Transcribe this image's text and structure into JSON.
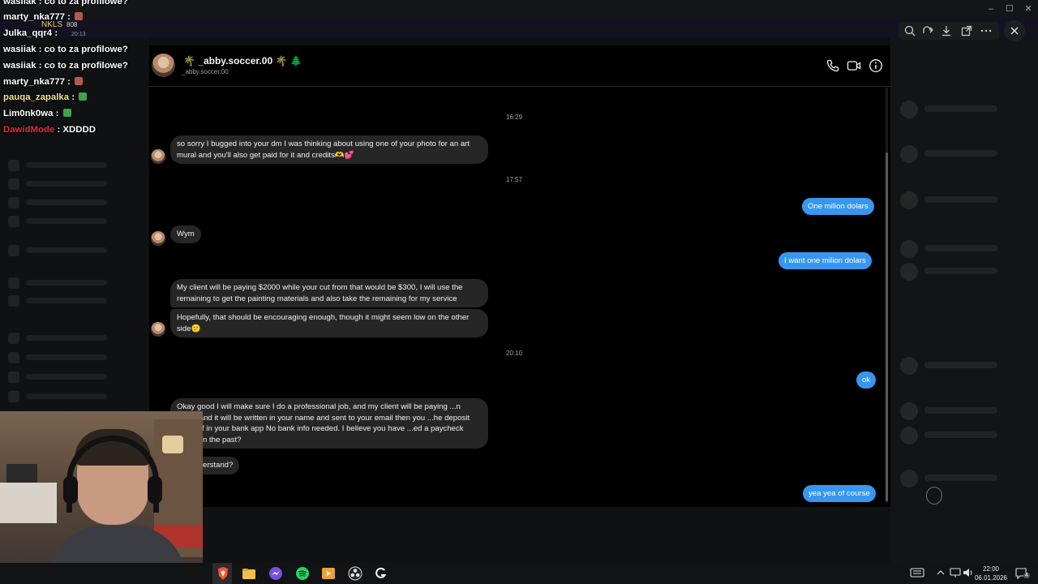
{
  "chat_overlay": {
    "lines": [
      {
        "user": "wasiiak",
        "text": " : co to za profilowe?",
        "color": "#ffffff"
      },
      {
        "user": "marty_nka777",
        "text": " : ",
        "color": "#ffffff"
      },
      {
        "user": "Julka_qqr4",
        "text": " : ",
        "color": "#ffffff"
      },
      {
        "user": "wasiiak",
        "text": " : co to za profilowe?",
        "color": "#ffffff"
      },
      {
        "user": "wasiiak",
        "text": " : co to za profilowe?",
        "color": "#ffffff"
      },
      {
        "user": "marty_nka777",
        "text": " : ",
        "color": "#ffffff"
      },
      {
        "user": "pauqa_zapalka",
        "text": " : ",
        "color": "#f3e38a"
      },
      {
        "user": "Lim0nk0wa",
        "text": " : ",
        "color": "#ffffff"
      },
      {
        "user": "DawidMode",
        "text": " : XDDDD",
        "color": "#e0303a"
      }
    ],
    "badge": {
      "name": "NKLS",
      "count": "808",
      "time": "20:13"
    }
  },
  "dm": {
    "contact_name": "🌴 _abby.soccer.00 🌴 🌲",
    "contact_handle": "_abby.soccer.00",
    "header_icons": [
      "phone-icon",
      "video-call-icon",
      "info-icon"
    ],
    "timestamps": {
      "t1": "16:29",
      "t2": "17:57",
      "t3": "20:10"
    },
    "messages": {
      "in_1": "so sorry I bugged into your dm I was thinking about using one of your photo for an art mural and you'll also get paid for it and  credits🫶💕",
      "out_1": "One milion dolars",
      "in_2": "Wym",
      "out_2": "I want one milion dolars",
      "in_3": "My client will be paying $2000 while your cut from that would be $300, I will use the remaining to get the painting materials and also take the remaining for my service",
      "in_4": "Hopefully, that should be encouraging enough, though it might seem low on the other side😕",
      "out_3": "ok",
      "in_5": "Okay good I will  make sure I do a professional job, and my client will be paying ...n check and it will be written in your name and sent to your email then you ...he deposit yourself in your bank app No bank info needed. I believe you have ...ed a paycheck before in the past?",
      "in_6": "...u understand?",
      "out_4": "yea yea of course"
    }
  },
  "taskbar": {
    "clock_time": "22:00",
    "clock_date": "06.01.2026",
    "notification_count": "4",
    "apps": [
      "brave-browser-icon",
      "file-explorer-icon",
      "messenger-icon",
      "spotify-icon",
      "media-player-icon",
      "obs-icon",
      "g-hub-icon"
    ]
  },
  "colors": {
    "outgoing_bubble": "#3797f0",
    "incoming_bubble": "#262626",
    "background": "#000000"
  }
}
